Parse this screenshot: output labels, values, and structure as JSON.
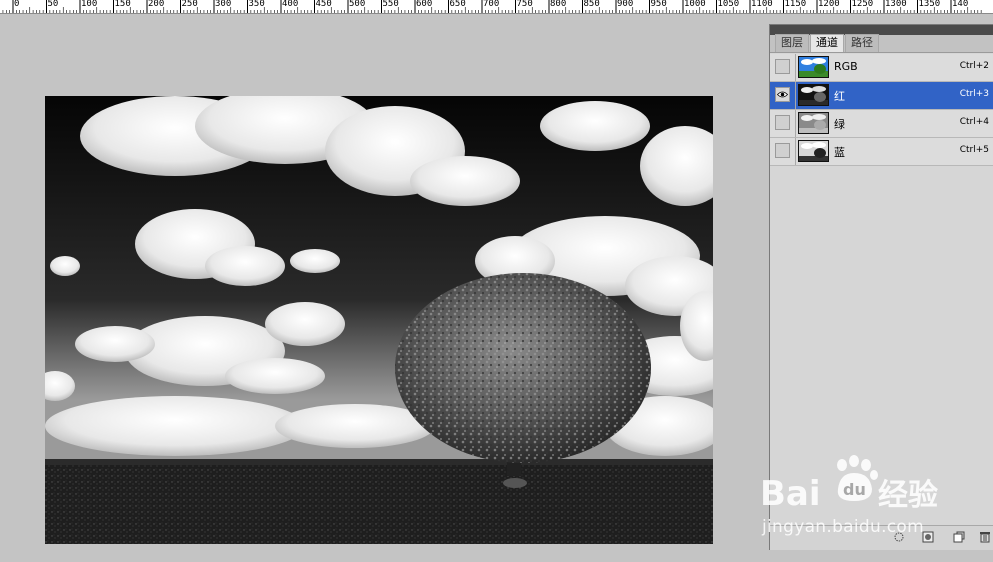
{
  "ruler": {
    "labels": [
      "50",
      "0",
      "50",
      "100",
      "150",
      "200",
      "250",
      "300",
      "350",
      "400",
      "450",
      "500",
      "550",
      "600",
      "650",
      "700",
      "750",
      "800",
      "850",
      "900",
      "950",
      "1000",
      "1050",
      "1100",
      "1150",
      "1200",
      "1250",
      "1300",
      "1350",
      "140"
    ]
  },
  "panel": {
    "tabs": [
      {
        "label": "图层",
        "active": false
      },
      {
        "label": "通道",
        "active": true
      },
      {
        "label": "路径",
        "active": false
      }
    ],
    "channels": [
      {
        "name": "RGB",
        "shortcut": "Ctrl+2",
        "visible": false,
        "selected": false
      },
      {
        "name": "红",
        "shortcut": "Ctrl+3",
        "visible": true,
        "selected": true
      },
      {
        "name": "绿",
        "shortcut": "Ctrl+4",
        "visible": false,
        "selected": false
      },
      {
        "name": "蓝",
        "shortcut": "Ctrl+5",
        "visible": false,
        "selected": false
      }
    ],
    "footer_icons": [
      "load-selection-icon",
      "save-selection-icon",
      "new-channel-icon",
      "delete-channel-icon"
    ]
  },
  "watermark": {
    "brand": "Bai",
    "brand_suffix": "经验",
    "url": "jingyan.baidu.com"
  },
  "colors": {
    "selection": "#3163c6",
    "workspace": "#c4c4c4"
  }
}
